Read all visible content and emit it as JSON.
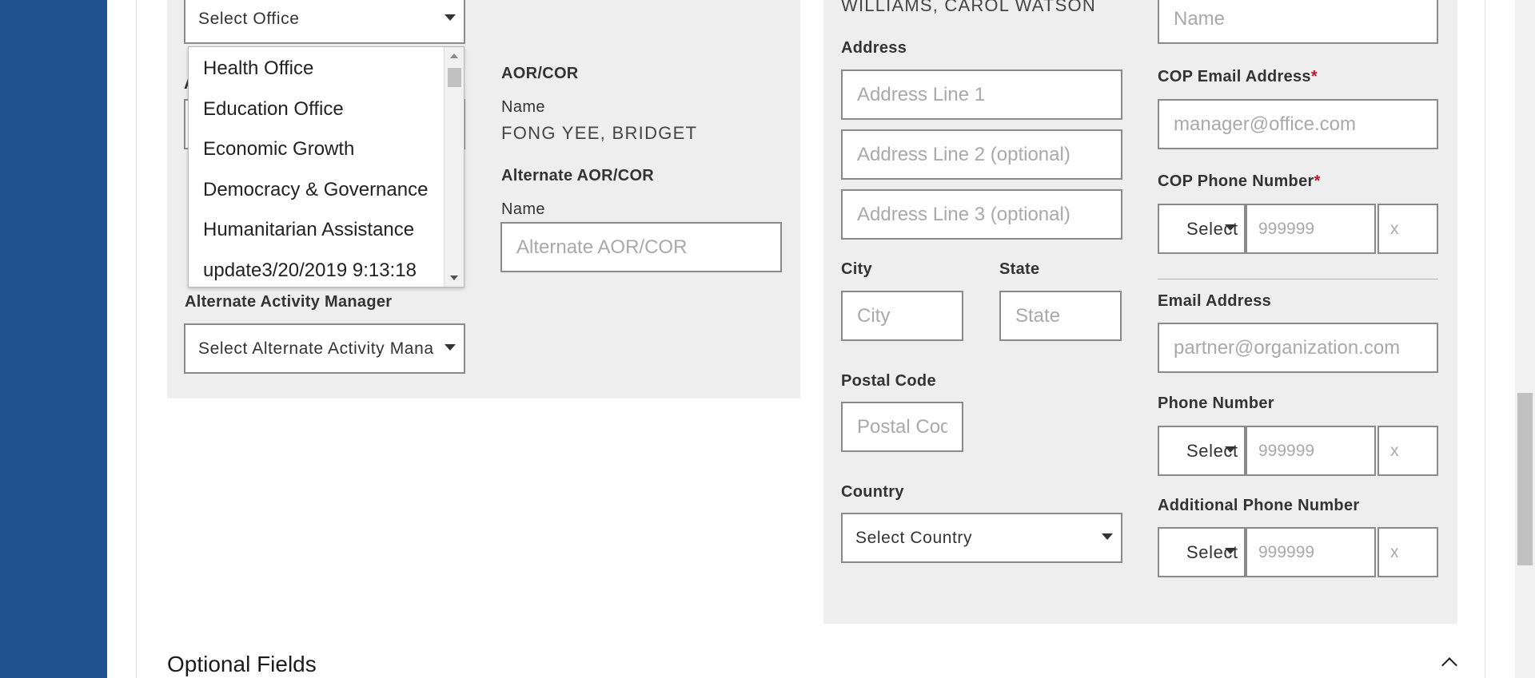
{
  "colors": {
    "rail": "#21518f",
    "panel": "#eeeeee",
    "required": "#c4122f",
    "border": "#8a8a8a"
  },
  "left": {
    "office_select": "Select Office",
    "office_options": [
      "Health Office",
      "Education Office",
      "Economic Growth",
      "Democracy & Governance",
      "Humanitarian Assistance",
      "update3/20/2019 9:13:18"
    ],
    "alt_activity_manager_label": "Alternate Activity Manager",
    "alt_activity_manager_select": "Select Alternate Activity Mana",
    "aor_cor_label": "AOR/COR",
    "aor_cor_name_label": "Name",
    "aor_cor_name_value": "FONG YEE, BRIDGET",
    "alt_aor_cor_label": "Alternate AOR/COR",
    "alt_aor_cor_name_label": "Name",
    "alt_aor_cor_placeholder": "Alternate AOR/COR"
  },
  "address": {
    "top_name_value": "WILLIAMS, CAROL WATSON",
    "label": "Address",
    "line1_placeholder": "Address Line 1",
    "line2_placeholder": "Address Line 2 (optional)",
    "line3_placeholder": "Address Line 3 (optional)",
    "city_label": "City",
    "city_placeholder": "City",
    "state_label": "State",
    "state_placeholder": "State",
    "postal_label": "Postal Code",
    "postal_placeholder": "Postal Code",
    "country_label": "Country",
    "country_select": "Select Country"
  },
  "contact": {
    "name_placeholder": "Name",
    "cop_email_label": "COP Email Address",
    "cop_email_placeholder": "manager@office.com",
    "cop_phone_label": "COP Phone Number",
    "required_mark": "*",
    "country_code_select": "Select",
    "phone_placeholder": "999999",
    "ext_placeholder": "x",
    "email_label": "Email Address",
    "email_placeholder": "partner@organization.com",
    "phone_label": "Phone Number",
    "additional_phone_label": "Additional Phone Number"
  },
  "optional_fields_title": "Optional Fields"
}
